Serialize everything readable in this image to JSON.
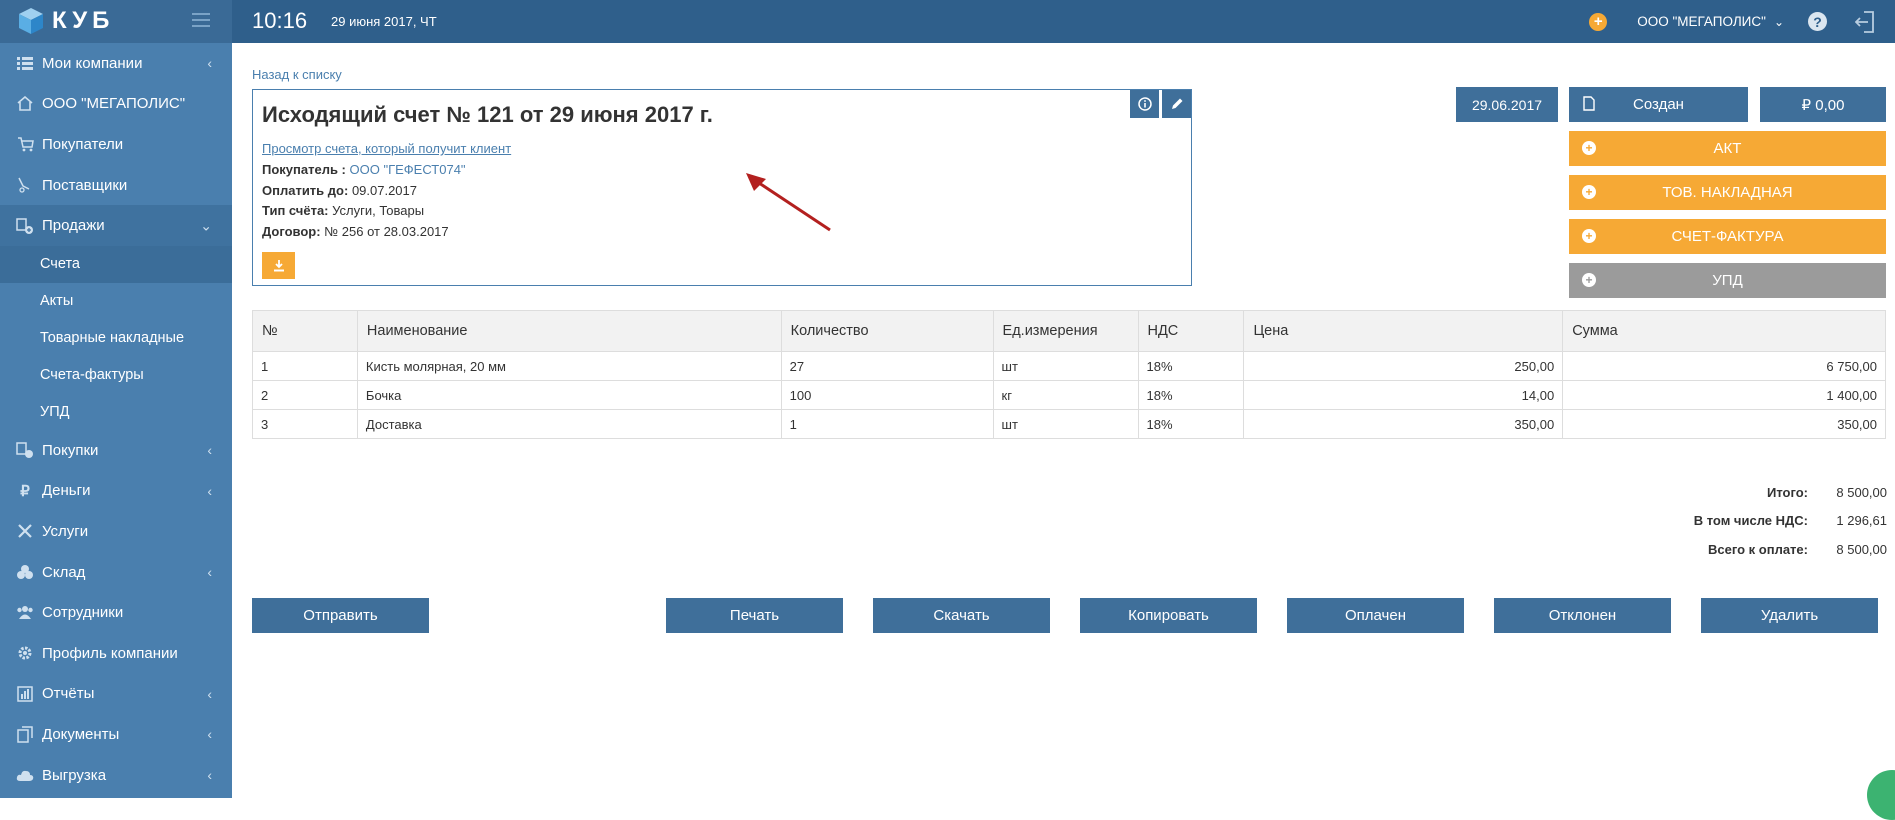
{
  "app": {
    "logo_text": "КУБ"
  },
  "topbar": {
    "time": "10:16",
    "date": "29 июня 2017, ЧТ",
    "company": "ООО \"МЕГАПОЛИС\""
  },
  "sidebar": {
    "items": [
      {
        "label": "Мои компании",
        "icon": "list-icon",
        "chevron": "‹"
      },
      {
        "label": "ООО \"МЕГАПОЛИС\"",
        "icon": "home-icon"
      },
      {
        "label": "Покупатели",
        "icon": "cart-icon"
      },
      {
        "label": "Поставщики",
        "icon": "truck-icon"
      },
      {
        "label": "Продажи",
        "icon": "sales-icon",
        "chevron": "⌄"
      },
      {
        "label": "Покупки",
        "icon": "purchases-icon",
        "chevron": "‹"
      },
      {
        "label": "Деньги",
        "icon": "ruble-icon",
        "chevron": "‹"
      },
      {
        "label": "Услуги",
        "icon": "tools-icon"
      },
      {
        "label": "Склад",
        "icon": "warehouse-icon",
        "chevron": "‹"
      },
      {
        "label": "Сотрудники",
        "icon": "users-icon"
      },
      {
        "label": "Профиль компании",
        "icon": "gear-icon"
      },
      {
        "label": "Отчёты",
        "icon": "reports-icon",
        "chevron": "‹"
      },
      {
        "label": "Документы",
        "icon": "documents-icon",
        "chevron": "‹"
      },
      {
        "label": "Выгрузка",
        "icon": "cloud-icon",
        "chevron": "‹"
      }
    ],
    "sales_sub": [
      {
        "label": "Счета"
      },
      {
        "label": "Акты"
      },
      {
        "label": "Товарные накладные"
      },
      {
        "label": "Счета-фактуры"
      },
      {
        "label": "УПД"
      }
    ]
  },
  "main": {
    "back_link": "Назад к списку",
    "invoice": {
      "title": "Исходящий счет № 121 от 29 июня 2017 г.",
      "preview_link": "Просмотр счета, который получит клиент",
      "buyer_label": "Покупатель :",
      "buyer_value": "ООО \"ГЕФЕСТ074\"",
      "pay_until_label": "Оплатить до:",
      "pay_until_value": "09.07.2017",
      "type_label": "Тип счёта:",
      "type_value": "Услуги, Товары",
      "contract_label": "Договор:",
      "contract_value": "№ 256 от 28.03.2017"
    },
    "date_badge": "29.06.2017",
    "status": "Создан",
    "amount": "₽ 0,00",
    "side_buttons": [
      "АКТ",
      "ТОВ. НАКЛАДНАЯ",
      "СЧЕТ-ФАКТУРА",
      "УПД"
    ],
    "table": {
      "headers": [
        "№",
        "Наименование",
        "Количество",
        "Ед.измерения",
        "НДС",
        "Цена",
        "Сумма"
      ],
      "rows": [
        [
          "1",
          "Кисть молярная, 20 мм",
          "27",
          "шт",
          "18%",
          "250,00",
          "6 750,00"
        ],
        [
          "2",
          "Бочка",
          "100",
          "кг",
          "18%",
          "14,00",
          "1 400,00"
        ],
        [
          "3",
          "Доставка",
          "1",
          "шт",
          "18%",
          "350,00",
          "350,00"
        ]
      ]
    },
    "totals": {
      "total_label": "Итого:",
      "total_value": "8 500,00",
      "vat_label": "В том числе НДС:",
      "vat_value": "1 296,61",
      "due_label": "Всего к оплате:",
      "due_value": "8 500,00"
    },
    "actions": [
      "Отправить",
      "Печать",
      "Скачать",
      "Копировать",
      "Оплачен",
      "Отклонен",
      "Удалить"
    ]
  }
}
